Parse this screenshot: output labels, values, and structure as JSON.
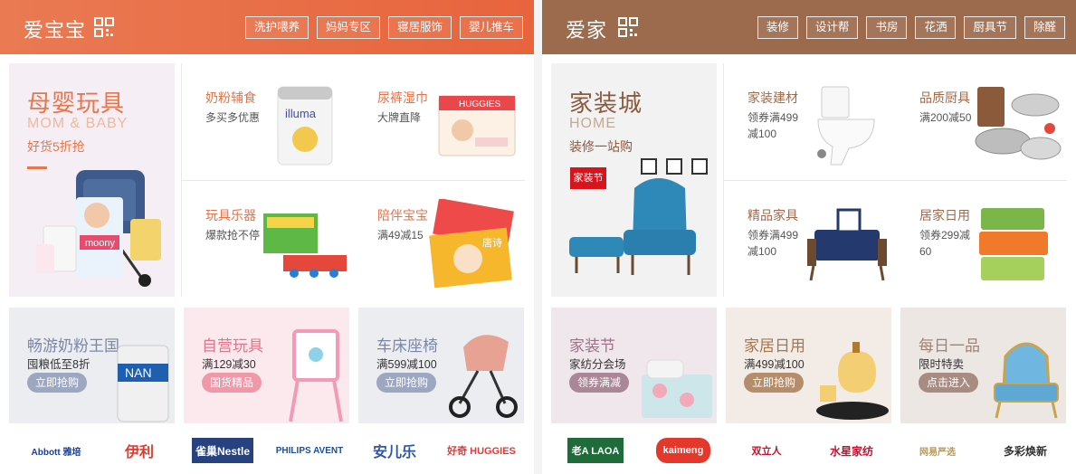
{
  "left": {
    "header": {
      "title": "爱宝宝",
      "tags": [
        "洗护喂养",
        "妈妈专区",
        "寝居服饰",
        "婴儿推车"
      ]
    },
    "featured": {
      "title": "母婴玩具",
      "subtitle": "MOM & BABY",
      "tagline": "好货5折抢"
    },
    "cells": [
      {
        "title": "奶粉辅食",
        "desc": "多买多优惠"
      },
      {
        "title": "尿裤湿巾",
        "desc": "大牌直降"
      },
      {
        "title": "玩具乐器",
        "desc": "爆款抢不停"
      },
      {
        "title": "陪伴宝宝",
        "desc": "满49减15"
      }
    ],
    "promos": [
      {
        "title": "畅游奶粉王国",
        "desc": "囤粮低至8折",
        "button": "立即抢购"
      },
      {
        "title": "自营玩具",
        "desc": "满129减30",
        "button": "国货精品"
      },
      {
        "title": "车床座椅",
        "desc": "满599减100",
        "button": "立即抢购"
      }
    ],
    "brands": [
      "Abbott 雅培",
      "伊利",
      "雀巢Nestle",
      "PHILIPS AVENT",
      "安儿乐",
      "好奇 HUGGIES"
    ],
    "accent": "#e8764d"
  },
  "right": {
    "header": {
      "title": "爱家",
      "tags": [
        "装修",
        "设计帮",
        "书房",
        "花洒",
        "厨具节",
        "除醛"
      ]
    },
    "featured": {
      "title": "家装城",
      "subtitle": "HOME",
      "tagline": "装修一站购",
      "badge": "家装节"
    },
    "cells": [
      {
        "title": "家装建材",
        "desc": "领券满499减100"
      },
      {
        "title": "品质厨具",
        "desc": "满200减50"
      },
      {
        "title": "精品家具",
        "desc": "领券满499减100"
      },
      {
        "title": "居家日用",
        "desc": "领券299减60"
      }
    ],
    "promos": [
      {
        "title": "家装节",
        "desc": "家纺分会场",
        "button": "领券满减"
      },
      {
        "title": "家居日用",
        "desc": "满499减100",
        "button": "立即抢购"
      },
      {
        "title": "每日一品",
        "desc": "限时特卖",
        "button": "点击进入"
      }
    ],
    "brands": [
      "老A LAOA",
      "kaimeng",
      "双立人",
      "水星家纺",
      "网易严选",
      "多彩焕新"
    ],
    "accent": "#9c6a4c"
  }
}
